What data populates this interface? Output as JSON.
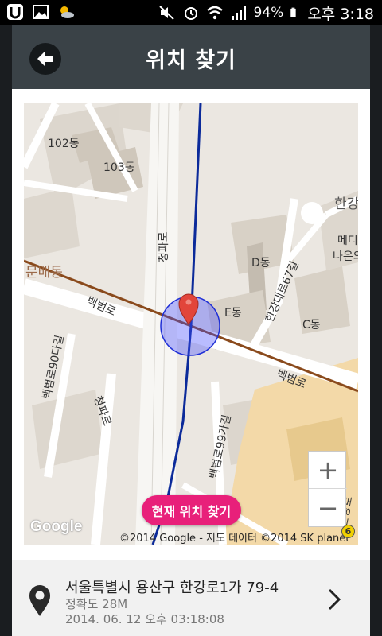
{
  "status_bar": {
    "battery": "94%",
    "time": "오후 3:18"
  },
  "header": {
    "title": "위치 찾기"
  },
  "map": {
    "labels": {
      "bldg_102": "102동",
      "bldg_103": "103동",
      "bldg_d": "D동",
      "bldg_e": "E동",
      "bldg_c": "C동",
      "area_munbae": "문배동",
      "road_baekbeom_1": "백범로",
      "road_baekbeom_2": "백범로",
      "road_cheongpa_1": "청파로",
      "road_cheongpa_2": "청파로",
      "road_baekbeom90": "백범로90다길",
      "road_baekbeom99": "백범로99가길",
      "road_hangang67": "한강대로67길",
      "place_hanggang": "한강",
      "place_medi": "메디",
      "place_naeun": "나은의",
      "road_hanggangro": "한강로"
    },
    "google_logo": "Google",
    "credit": "©2014 Google - 지도 데이터 ©2014 SK planet",
    "zoom_in_label": "+",
    "zoom_out_label": "−",
    "find_current_label": "현재 위치 찾기",
    "badge": "6"
  },
  "address": {
    "main": "서울특별시 용산구 한강로1가 79-4",
    "accuracy": "정확도 28M",
    "timestamp": "2014. 06. 12 오후 03:18:08"
  }
}
